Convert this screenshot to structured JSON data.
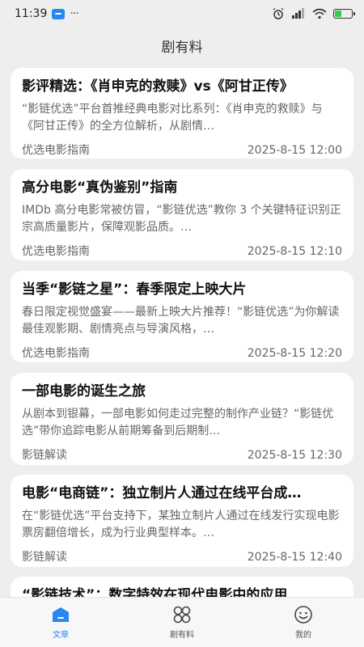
{
  "status_bar": {
    "time": "11:39",
    "dots": "···"
  },
  "header": {
    "title": "剧有料"
  },
  "articles": [
    {
      "title": "影评精选：《肖申克的救赎》vs《阿甘正传》",
      "summary": "“影链优选”平台首推经典电影对比系列：《肖申克的救赎》与《阿甘正传》的全方位解析，从剧情…",
      "source": "优选电影指南",
      "date": "2025-8-15 12:00"
    },
    {
      "title": "高分电影“真伪鉴别”指南",
      "summary": "IMDb 高分电影常被仿冒，“影链优选”教你 3 个关键特征识别正宗高质量影片，保障观影品质。…",
      "source": "优选电影指南",
      "date": "2025-8-15 12:10"
    },
    {
      "title": "当季“影链之星”：春季限定上映大片",
      "summary": "春日限定视觉盛宴——最新上映大片推荐！“影链优选”为你解读最佳观影期、剧情亮点与导演风格，…",
      "source": "优选电影指南",
      "date": "2025-8-15 12:20"
    },
    {
      "title": "一部电影的诞生之旅",
      "summary": "从剧本到银幕，一部电影如何走过完整的制作产业链？“影链优选”带你追踪电影从前期筹备到后期制…",
      "source": "影链解读",
      "date": "2025-8-15 12:30"
    },
    {
      "title": "电影“电商链”：独立制片人通过在线平台成…",
      "summary": "在“影链优选”平台支持下，某独立制片人通过在线发行实现电影票房翻倍增长，成为行业典型样本。…",
      "source": "影链解读",
      "date": "2025-8-15 12:40"
    },
    {
      "title": "“影链技术”：数字特效在现代电影中的应用",
      "summary": "",
      "source": "",
      "date": ""
    }
  ],
  "tabs": [
    {
      "label": "文章",
      "icon": "article-icon",
      "active": true
    },
    {
      "label": "剧有料",
      "icon": "grid-icon",
      "active": false
    },
    {
      "label": "我的",
      "icon": "smiley-icon",
      "active": false
    }
  ],
  "colors": {
    "accent": "#2a86f0",
    "background": "#eeeeef",
    "card": "#ffffff"
  }
}
